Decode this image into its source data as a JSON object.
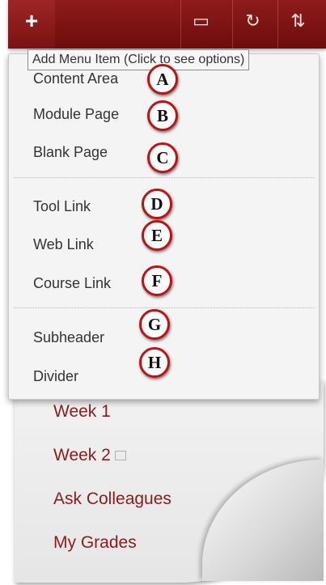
{
  "toolbar": {
    "add_icon": "plus-icon",
    "add_glyph": "+",
    "buttons": [
      {
        "icon": "window-icon",
        "glyph": "▭"
      },
      {
        "icon": "refresh-icon",
        "glyph": "↻"
      },
      {
        "icon": "sort-icon",
        "glyph": "⇅"
      }
    ]
  },
  "tooltip": "Add Menu Item (Click to see options)",
  "dropdown": {
    "items": [
      {
        "label": "Content Area",
        "marker": "A"
      },
      {
        "label": "Module Page",
        "marker": "B"
      },
      {
        "label": "Blank Page",
        "marker": "C"
      },
      {
        "label": "Tool Link",
        "marker": "D"
      },
      {
        "label": "Web Link",
        "marker": "E"
      },
      {
        "label": "Course Link",
        "marker": "F"
      },
      {
        "label": "Subheader",
        "marker": "G"
      },
      {
        "label": "Divider",
        "marker": "H"
      }
    ]
  },
  "course_menu": {
    "items": [
      "Week 1",
      "Week 2",
      "Ask Colleagues",
      "My Grades"
    ]
  },
  "colors": {
    "toolbar": "#7d1414",
    "link_text": "#8a1c1c",
    "marker_ring": "#c01212"
  }
}
